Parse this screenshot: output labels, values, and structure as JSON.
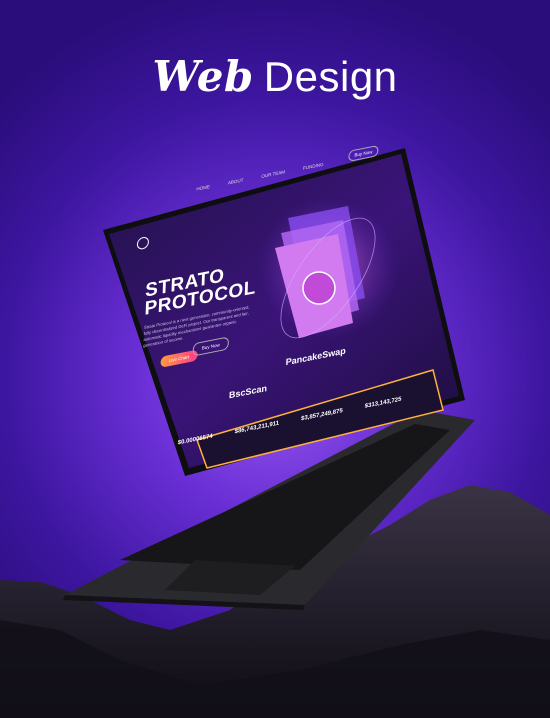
{
  "heading": {
    "script": "Web",
    "plain": "Design"
  },
  "site": {
    "nav": [
      "HOME",
      "ABOUT",
      "OUR TEAM",
      "FUNDING"
    ],
    "buy_button": "Buy Now",
    "hero_title": "STRATO PROTOCOL",
    "hero_text": "Strato Protocol is a next generation, community-oriented, fully decentralized DeFi project. Our transparent and fair, automatic liquidity mechanisms guarantee organic generation of income.",
    "cta_primary": "Live Chart",
    "cta_secondary": "Buy Now",
    "partners": [
      "BscScan",
      "PancakeSwap"
    ],
    "stats": [
      "$0.00006574",
      "$86,743,211,911",
      "$3,857,249,875",
      "$313,143,725"
    ]
  },
  "colors": {
    "bg_center": "#9b5cf0",
    "bg_edge": "#2a0d7a",
    "accent_gradient": [
      "#ff9a3c",
      "#ff3c8a"
    ]
  }
}
